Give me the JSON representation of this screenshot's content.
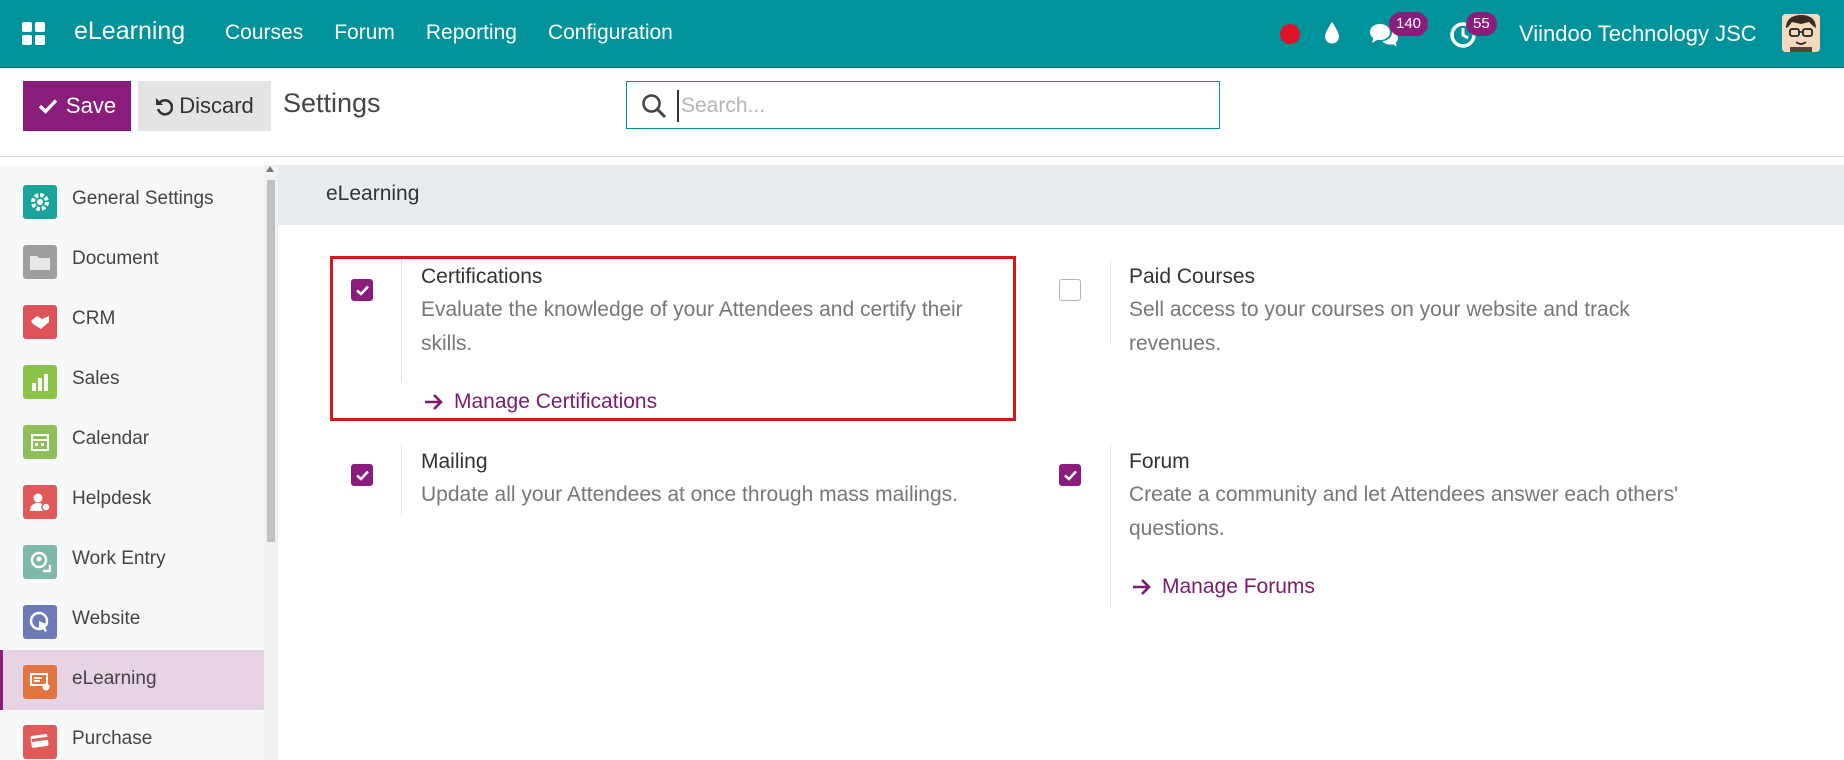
{
  "nav": {
    "brand": "eLearning",
    "menu": [
      "Courses",
      "Forum",
      "Reporting",
      "Configuration"
    ],
    "chat_count": "140",
    "activity_count": "55",
    "company": "Viindoo Technology JSC"
  },
  "control": {
    "save_label": "Save",
    "discard_label": "Discard",
    "title": "Settings",
    "search_placeholder": "Search..."
  },
  "sidebar": {
    "items": [
      {
        "label": "General Settings",
        "icon": "gear-icon",
        "color": "#1aa39b"
      },
      {
        "label": "Document",
        "icon": "folder-icon",
        "color": "#9e9e9e"
      },
      {
        "label": "CRM",
        "icon": "handshake-icon",
        "color": "#e0525a"
      },
      {
        "label": "Sales",
        "icon": "chart-icon",
        "color": "#8bc34a"
      },
      {
        "label": "Calendar",
        "icon": "calendar-icon",
        "color": "#8fbf5a"
      },
      {
        "label": "Helpdesk",
        "icon": "person-support-icon",
        "color": "#e05a5a"
      },
      {
        "label": "Work Entry",
        "icon": "person-clock-icon",
        "color": "#7fb8a8"
      },
      {
        "label": "Website",
        "icon": "globe-icon",
        "color": "#6c7ab8"
      },
      {
        "label": "eLearning",
        "icon": "presentation-icon",
        "color": "#e2753f",
        "active": true
      },
      {
        "label": "Purchase",
        "icon": "card-icon",
        "color": "#e05a5a"
      }
    ]
  },
  "section": {
    "title": "eLearning",
    "settings": [
      {
        "title": "Certifications",
        "desc": "Evaluate the knowledge of your Attendees and certify their skills.",
        "checked": true,
        "link": "Manage Certifications"
      },
      {
        "title": "Paid Courses",
        "desc": "Sell access to your courses on your website and track revenues.",
        "checked": false
      },
      {
        "title": "Mailing",
        "desc": "Update all your Attendees at once through mass mailings.",
        "checked": true
      },
      {
        "title": "Forum",
        "desc": "Create a community and let Attendees answer each others' questions.",
        "checked": true,
        "link": "Manage Forums"
      }
    ]
  },
  "colors": {
    "primary": "#8a1c7c",
    "navbar": "#00939c",
    "highlight": "#d9151b"
  }
}
